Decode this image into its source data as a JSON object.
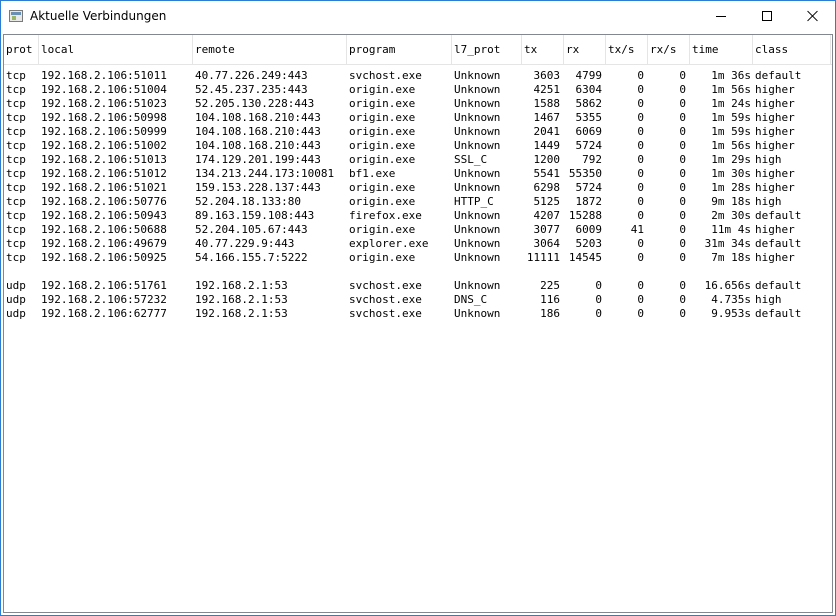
{
  "window": {
    "title": "Aktuelle Verbindungen"
  },
  "columns": [
    "prot",
    "local",
    "remote",
    "program",
    "l7_prot",
    "tx",
    "rx",
    "tx/s",
    "rx/s",
    "time",
    "class"
  ],
  "tcp_rows": [
    {
      "prot": "tcp",
      "local": "192.168.2.106:51011",
      "remote": "40.77.226.249:443",
      "program": "svchost.exe",
      "l7": "Unknown",
      "tx": "3603",
      "rx": "4799",
      "txs": "0",
      "rxs": "0",
      "time": "1m 36s",
      "class": "default"
    },
    {
      "prot": "tcp",
      "local": "192.168.2.106:51004",
      "remote": "52.45.237.235:443",
      "program": "origin.exe",
      "l7": "Unknown",
      "tx": "4251",
      "rx": "6304",
      "txs": "0",
      "rxs": "0",
      "time": "1m 56s",
      "class": "higher"
    },
    {
      "prot": "tcp",
      "local": "192.168.2.106:51023",
      "remote": "52.205.130.228:443",
      "program": "origin.exe",
      "l7": "Unknown",
      "tx": "1588",
      "rx": "5862",
      "txs": "0",
      "rxs": "0",
      "time": "1m 24s",
      "class": "higher"
    },
    {
      "prot": "tcp",
      "local": "192.168.2.106:50998",
      "remote": "104.108.168.210:443",
      "program": "origin.exe",
      "l7": "Unknown",
      "tx": "1467",
      "rx": "5355",
      "txs": "0",
      "rxs": "0",
      "time": "1m 59s",
      "class": "higher"
    },
    {
      "prot": "tcp",
      "local": "192.168.2.106:50999",
      "remote": "104.108.168.210:443",
      "program": "origin.exe",
      "l7": "Unknown",
      "tx": "2041",
      "rx": "6069",
      "txs": "0",
      "rxs": "0",
      "time": "1m 59s",
      "class": "higher"
    },
    {
      "prot": "tcp",
      "local": "192.168.2.106:51002",
      "remote": "104.108.168.210:443",
      "program": "origin.exe",
      "l7": "Unknown",
      "tx": "1449",
      "rx": "5724",
      "txs": "0",
      "rxs": "0",
      "time": "1m 56s",
      "class": "higher"
    },
    {
      "prot": "tcp",
      "local": "192.168.2.106:51013",
      "remote": "174.129.201.199:443",
      "program": "origin.exe",
      "l7": "SSL_C",
      "tx": "1200",
      "rx": "792",
      "txs": "0",
      "rxs": "0",
      "time": "1m 29s",
      "class": "high"
    },
    {
      "prot": "tcp",
      "local": "192.168.2.106:51012",
      "remote": "134.213.244.173:10081",
      "program": "bf1.exe",
      "l7": "Unknown",
      "tx": "5541",
      "rx": "55350",
      "txs": "0",
      "rxs": "0",
      "time": "1m 30s",
      "class": "higher"
    },
    {
      "prot": "tcp",
      "local": "192.168.2.106:51021",
      "remote": "159.153.228.137:443",
      "program": "origin.exe",
      "l7": "Unknown",
      "tx": "6298",
      "rx": "5724",
      "txs": "0",
      "rxs": "0",
      "time": "1m 28s",
      "class": "higher"
    },
    {
      "prot": "tcp",
      "local": "192.168.2.106:50776",
      "remote": "52.204.18.133:80",
      "program": "origin.exe",
      "l7": "HTTP_C",
      "tx": "5125",
      "rx": "1872",
      "txs": "0",
      "rxs": "0",
      "time": "9m 18s",
      "class": "high"
    },
    {
      "prot": "tcp",
      "local": "192.168.2.106:50943",
      "remote": "89.163.159.108:443",
      "program": "firefox.exe",
      "l7": "Unknown",
      "tx": "4207",
      "rx": "15288",
      "txs": "0",
      "rxs": "0",
      "time": "2m 30s",
      "class": "default"
    },
    {
      "prot": "tcp",
      "local": "192.168.2.106:50688",
      "remote": "52.204.105.67:443",
      "program": "origin.exe",
      "l7": "Unknown",
      "tx": "3077",
      "rx": "6009",
      "txs": "41",
      "rxs": "0",
      "time": "11m 4s",
      "class": "higher"
    },
    {
      "prot": "tcp",
      "local": "192.168.2.106:49679",
      "remote": "40.77.229.9:443",
      "program": "explorer.exe",
      "l7": "Unknown",
      "tx": "3064",
      "rx": "5203",
      "txs": "0",
      "rxs": "0",
      "time": "31m 34s",
      "class": "default"
    },
    {
      "prot": "tcp",
      "local": "192.168.2.106:50925",
      "remote": "54.166.155.7:5222",
      "program": "origin.exe",
      "l7": "Unknown",
      "tx": "11111",
      "rx": "14545",
      "txs": "0",
      "rxs": "0",
      "time": "7m 18s",
      "class": "higher"
    }
  ],
  "udp_rows": [
    {
      "prot": "udp",
      "local": "192.168.2.106:51761",
      "remote": "192.168.2.1:53",
      "program": "svchost.exe",
      "l7": "Unknown",
      "tx": "225",
      "rx": "0",
      "txs": "0",
      "rxs": "0",
      "time": "16.656s",
      "class": "default"
    },
    {
      "prot": "udp",
      "local": "192.168.2.106:57232",
      "remote": "192.168.2.1:53",
      "program": "svchost.exe",
      "l7": "DNS_C",
      "tx": "116",
      "rx": "0",
      "txs": "0",
      "rxs": "0",
      "time": "4.735s",
      "class": "high"
    },
    {
      "prot": "udp",
      "local": "192.168.2.106:62777",
      "remote": "192.168.2.1:53",
      "program": "svchost.exe",
      "l7": "Unknown",
      "tx": "186",
      "rx": "0",
      "txs": "0",
      "rxs": "0",
      "time": "9.953s",
      "class": "default"
    }
  ]
}
